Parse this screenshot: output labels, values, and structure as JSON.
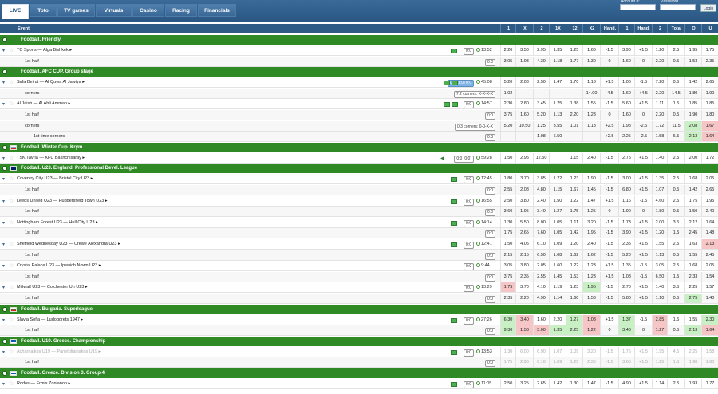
{
  "nav": {
    "tabs": [
      "LIVE",
      "Toto",
      "TV games",
      "Virtuals",
      "Casino",
      "Racing",
      "Financials"
    ],
    "active": "LIVE"
  },
  "login": {
    "account_label": "Account #:",
    "password_label": "Password",
    "login_label": "Login"
  },
  "table": {
    "event_label": "Event",
    "columns": [
      "1",
      "X",
      "2",
      "1X",
      "12",
      "X2",
      "Hand.",
      "1",
      "Hand.",
      "2",
      "Total",
      "O",
      "U"
    ]
  },
  "rows": [
    {
      "t": "league",
      "name": "Football. Friendly",
      "flag": ""
    },
    {
      "t": "match",
      "name": "TC Sports — Alga Bishkek",
      "tv": 1,
      "score": "0:0",
      "time": "13:52",
      "odds": [
        "2.20",
        "3.50",
        "2.95",
        "1.35",
        "1.25",
        "1.60",
        "-1.5",
        "3.90",
        "+1.5",
        "1.20",
        "2.5",
        "1.95",
        "1.75"
      ]
    },
    {
      "t": "sub",
      "name": "1st half",
      "score": "0:0",
      "odds": [
        "3.05",
        "1.93",
        "4.30",
        "1.18",
        "1.77",
        "1.30",
        "0",
        "1.60",
        "0",
        "2.20",
        "0.5",
        "1.53",
        "2.35"
      ]
    },
    {
      "t": "league",
      "name": "Football. AFC CUP. Group stage",
      "flag": ""
    },
    {
      "t": "match",
      "name": "Safa Beirut — Al Quwa Al Jawiya",
      "tv": 2,
      "score": "0:0 (1:0) 0:0",
      "scoreblue": 1,
      "time": "45:08",
      "odds": [
        "5.20",
        "2.03",
        "2.50",
        "1.47",
        "1.70",
        "1.13",
        "+1.5",
        "1.06",
        "-1.5",
        "7.20",
        "0.5",
        "1.42",
        "2.65"
      ]
    },
    {
      "t": "sub",
      "name": "corners",
      "score": "7:2 corners: X-X-X-X",
      "odds": [
        "1.02",
        "",
        "",
        "",
        "",
        "14.00",
        "-4.5",
        "1.60",
        "+4.5",
        "2.20",
        "14.5",
        "1.80",
        "1.90"
      ]
    },
    {
      "t": "match",
      "name": "Al Jaish — Al Ahli Amman",
      "tv": 2,
      "score": "0:0",
      "time": "14:57",
      "odds": [
        "2.30",
        "2.80",
        "3.45",
        "1.25",
        "1.38",
        "1.55",
        "-1.5",
        "5.60",
        "+1.5",
        "1.11",
        "1.5",
        "1.85",
        "1.85"
      ]
    },
    {
      "t": "sub",
      "name": "1st half",
      "score": "0:0",
      "odds": [
        "3.75",
        "1.60",
        "5.20",
        "1.13",
        "2.20",
        "1.23",
        "0",
        "1.60",
        "0",
        "2.20",
        "0.5",
        "1.90",
        "1.80"
      ]
    },
    {
      "t": "sub",
      "name": "corners",
      "score": "0:3 corners: 0-0-X-X",
      "odds": [
        "5.20",
        "10.50",
        "1.25",
        "3.55",
        "1.01",
        "1.13",
        "+2.5",
        "1.98",
        "-2.5",
        "1.72",
        "11.5",
        "2.08",
        "1.67"
      ],
      "hl": {
        "11": "g",
        "12": "r"
      }
    },
    {
      "t": "sub2",
      "name": "1st time corners",
      "score": "0:3",
      "odds": [
        "",
        "",
        "1.08",
        "6.50",
        "",
        "",
        "+2.5",
        "2.25",
        "-2.5",
        "1.58",
        "6.5",
        "2.13",
        "1.64"
      ],
      "hl": {
        "11": "g",
        "12": "r"
      }
    },
    {
      "t": "league",
      "name": "Football. Winter Cup. Krym",
      "flag": "ru"
    },
    {
      "t": "match",
      "name": "TSK Tavria — KFU Bakhchisaray",
      "speaker": 1,
      "score": "0:0 (0:0)",
      "time": "59:28",
      "odds": [
        "1.50",
        "2.95",
        "12.50",
        "",
        "1.15",
        "2.40",
        "-1.5",
        "2.75",
        "+1.5",
        "1.40",
        "2.5",
        "2.00",
        "1.72"
      ]
    },
    {
      "t": "league",
      "name": "Football. U23. England. Professional Devel. League",
      "flag": "gb"
    },
    {
      "t": "match",
      "name": "Coventry City U23 — Bristol City U23",
      "tv": 1,
      "score": "0:0",
      "time": "12:45",
      "odds": [
        "1.80",
        "3.70",
        "3.85",
        "1.22",
        "1.23",
        "1.90",
        "-1.5",
        "3.00",
        "+1.5",
        "1.35",
        "2.5",
        "1.68",
        "2.05"
      ]
    },
    {
      "t": "sub",
      "name": "1st half",
      "score": "0:0",
      "odds": [
        "2.55",
        "2.08",
        "4.80",
        "1.15",
        "1.67",
        "1.45",
        "-1.5",
        "6.80",
        "+1.5",
        "1.07",
        "0.5",
        "1.42",
        "2.65"
      ]
    },
    {
      "t": "match",
      "name": "Leeds United U23 — Huddersfield Town U23",
      "tv": 1,
      "score": "0:0",
      "time": "16:55",
      "odds": [
        "2.50",
        "3.80",
        "2.40",
        "1.50",
        "1.22",
        "1.47",
        "+1.5",
        "1.16",
        "-1.5",
        "4.60",
        "2.5",
        "1.75",
        "1.95"
      ]
    },
    {
      "t": "sub",
      "name": "1st half",
      "score": "0:0",
      "odds": [
        "3.60",
        "1.95",
        "3.40",
        "1.27",
        "1.75",
        "1.25",
        "0",
        "1.90",
        "0",
        "1.80",
        "0.5",
        "1.50",
        "2.40"
      ]
    },
    {
      "t": "match",
      "name": "Nottingham Forest U23 — Hull City U23",
      "tv": 1,
      "score": "0:0",
      "time": "14:14",
      "odds": [
        "1.30",
        "5.50",
        "8.00",
        "1.05",
        "1.11",
        "3.20",
        "-1.5",
        "1.73",
        "+1.5",
        "2.00",
        "3.5",
        "2.12",
        "1.64"
      ]
    },
    {
      "t": "sub",
      "name": "1st half",
      "score": "0:0",
      "odds": [
        "1.75",
        "2.65",
        "7.60",
        "1.05",
        "1.42",
        "1.95",
        "-1.5",
        "3.90",
        "+1.5",
        "1.20",
        "1.5",
        "2.45",
        "1.48"
      ]
    },
    {
      "t": "match",
      "name": "Sheffield Wednesday U23 — Crewe Alexandra U23",
      "tv": 1,
      "score": "0:0",
      "time": "12:41",
      "odds": [
        "1.50",
        "4.05",
        "6.10",
        "1.09",
        "1.20",
        "2.40",
        "-1.5",
        "2.35",
        "+1.5",
        "1.55",
        "2.5",
        "1.63",
        "2.13"
      ],
      "hl": {
        "12": "r"
      }
    },
    {
      "t": "sub",
      "name": "1st half",
      "score": "0:0",
      "odds": [
        "2.15",
        "2.15",
        "6.50",
        "1.08",
        "1.62",
        "1.62",
        "-1.5",
        "5.20",
        "+1.5",
        "1.13",
        "0.5",
        "1.55",
        "2.45"
      ]
    },
    {
      "t": "match",
      "name": "Crystal Palace U23 — Ipswich Nown U23",
      "score": "0:0",
      "time": "9:44",
      "odds": [
        "3.05",
        "3.80",
        "2.05",
        "1.60",
        "1.22",
        "1.23",
        "+1.5",
        "1.35",
        "-1.5",
        "3.05",
        "2.5",
        "1.68",
        "2.05"
      ]
    },
    {
      "t": "sub",
      "name": "1st half",
      "score": "0:0",
      "odds": [
        "3.75",
        "2.35",
        "2.55",
        "1.45",
        "1.53",
        "1.23",
        "+1.5",
        "1.08",
        "-1.5",
        "6.50",
        "1.5",
        "2.33",
        "1.54"
      ]
    },
    {
      "t": "match",
      "name": "Millwall U23 — Colchester Un U23",
      "score": "0:0",
      "time": "13:29",
      "odds": [
        "1.75",
        "3.70",
        "4.10",
        "1.19",
        "1.23",
        "1.95",
        "-1.5",
        "2.70",
        "+1.5",
        "1.40",
        "3.5",
        "2.25",
        "1.57"
      ],
      "hl": {
        "0": "r",
        "5": "g"
      }
    },
    {
      "t": "sub",
      "name": "1st half",
      "score": "0:0",
      "odds": [
        "2.35",
        "2.20",
        "4.90",
        "1.14",
        "1.60",
        "1.53",
        "-1.5",
        "5.80",
        "+1.5",
        "1.10",
        "0.5",
        "2.75",
        "1.40"
      ],
      "hl": {
        "11": "g"
      }
    },
    {
      "t": "league",
      "name": "Football. Bulgaria. Superleague",
      "flag": "bg"
    },
    {
      "t": "match",
      "name": "Slavia Sofia — Ludogorets 1947",
      "tv": 1,
      "score": "0:0",
      "time": "27:26",
      "odds": [
        "6.30",
        "3.40",
        "1.60",
        "2.20",
        "1.27",
        "1.08",
        "+1.5",
        "1.37",
        "-1.5",
        "2.85",
        "1.5",
        "1.55",
        "2.30"
      ],
      "hl": {
        "0": "g",
        "1": "r",
        "4": "g",
        "5": "r",
        "7": "g",
        "9": "r",
        "12": "g"
      }
    },
    {
      "t": "sub",
      "name": "1st half",
      "score": "0:0",
      "odds": [
        "9.30",
        "1.58",
        "3.00",
        "1.35",
        "2.25",
        "1.22",
        "0",
        "3.40",
        "0",
        "1.27",
        "0.5",
        "2.13",
        "1.64"
      ],
      "hl": {
        "0": "g",
        "1": "r",
        "2": "r",
        "3": "g",
        "4": "g",
        "5": "r",
        "7": "g",
        "9": "r",
        "11": "g",
        "12": "r"
      }
    },
    {
      "t": "league",
      "name": "Football. U19. Greece. Championship",
      "flag": "gr"
    },
    {
      "t": "match",
      "name": "Acharnaikos U19 — Panetolianiakos U19",
      "dim": 1,
      "tv": 1,
      "score": "0:0",
      "time": "13:53",
      "odds": [
        "1.30",
        "6.00",
        "6.90",
        "1.07",
        "1.09",
        "3.20",
        "-1.5",
        "1.75",
        "+1.5",
        "1.95",
        "4.5",
        "2.25",
        "1.58"
      ]
    },
    {
      "t": "sub",
      "name": "1st half",
      "dim": 1,
      "score": "0:0",
      "odds": [
        "1.75",
        "2.90",
        "6.10",
        "1.09",
        "1.25",
        "2.35",
        "-1.5",
        "3.65",
        "+1.5",
        "1.25",
        "1.5",
        "1.90",
        "1.80"
      ]
    },
    {
      "t": "league",
      "name": "Football. Greece. Division 3. Group 4",
      "flag": "gr"
    },
    {
      "t": "match",
      "name": "Rodos — Ermis Zonianon",
      "tv": 1,
      "score": "0:0",
      "time": "11:05",
      "odds": [
        "2.50",
        "3.25",
        "2.65",
        "1.42",
        "1.30",
        "1.47",
        "-1.5",
        "4.90",
        "+1.5",
        "1.14",
        "2.5",
        "1.93",
        "1.77"
      ]
    }
  ],
  "colors": {
    "nav_bg": "#2a5683",
    "header_bg": "#2e5a86",
    "league_bg": "#2f8a26",
    "odds_up": "#c9efc4",
    "odds_down": "#f6c5c5"
  }
}
